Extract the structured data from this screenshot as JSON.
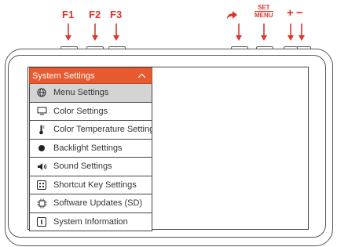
{
  "callouts": {
    "f1": "F1",
    "f2": "F2",
    "f3": "F3",
    "set_top": "SET",
    "set_bottom": "MENU",
    "plus": "+",
    "minus": "−"
  },
  "accent_color": "#e0342b",
  "menu": {
    "title": "System Settings",
    "header_color": "#e8592f",
    "items": [
      {
        "label": "Menu Settings",
        "icon": "globe-icon",
        "selected": true
      },
      {
        "label": "Color Settings",
        "icon": "monitor-icon",
        "selected": false
      },
      {
        "label": "Color Temperature Settings",
        "icon": "thermometer-icon",
        "selected": false
      },
      {
        "label": "Backlight Settings",
        "icon": "backlight-dot-icon",
        "selected": false
      },
      {
        "label": "Sound Settings",
        "icon": "speaker-icon",
        "selected": false
      },
      {
        "label": "Shortcut Key Settings",
        "icon": "shortcut-grid-icon",
        "selected": false
      },
      {
        "label": "Software Updates (SD)",
        "icon": "chip-icon",
        "selected": false
      },
      {
        "label": "System Information",
        "icon": "info-icon",
        "selected": false
      }
    ]
  }
}
